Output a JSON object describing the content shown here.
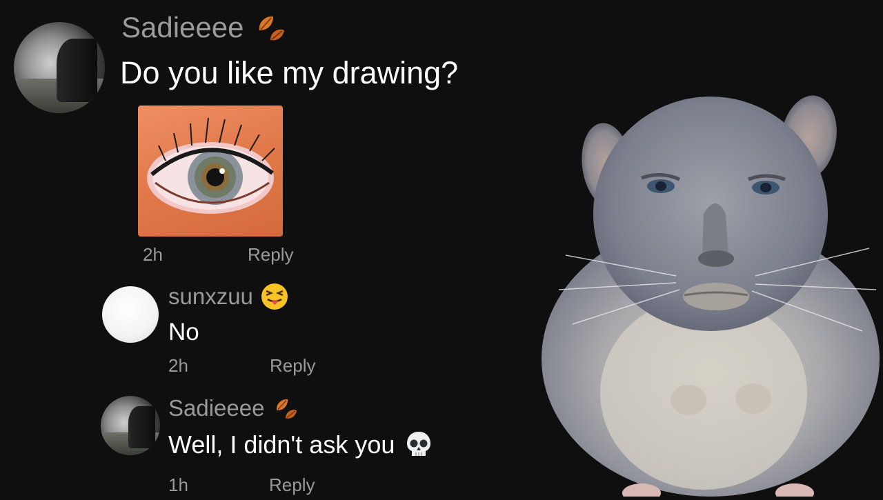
{
  "comments": [
    {
      "username": "Sadieeee",
      "badge_icon": "autumn-leaves-icon",
      "text": "Do you like my drawing?",
      "time": "2h",
      "reply_label": "Reply",
      "attachment": "eye-drawing-image"
    },
    {
      "username": "sunxzuu",
      "badge_icon": "squinting-tongue-face-emoji",
      "text": "No",
      "time": "2h",
      "reply_label": "Reply"
    },
    {
      "username": "Sadieeee",
      "badge_icon": "autumn-leaves-icon",
      "text": "Well, I didn't ask you",
      "text_emoji": "skull-emoji",
      "time": "1h",
      "reply_label": "Reply"
    }
  ],
  "decoration": {
    "right_image": "chinchilla-with-face-image"
  },
  "colors": {
    "background": "#0f0f10",
    "username": "#9a9a9a",
    "text": "#ffffff",
    "leaf": "#d9772b"
  }
}
